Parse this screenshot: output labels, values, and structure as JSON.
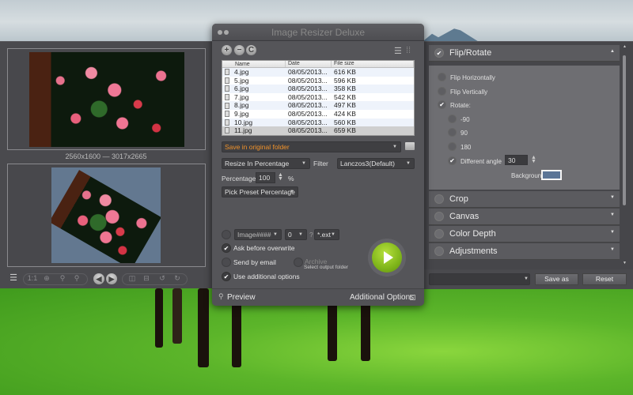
{
  "window": {
    "title": "Image Resizer Deluxe"
  },
  "preview": {
    "dimensions": "2560x1600 — 3017x2665",
    "toolbar": {
      "list_icon": "list-icon",
      "actual_size": "1:1",
      "fit_icon": "fit-icon",
      "zoom_out_icon": "zoom-out-icon",
      "zoom_in_icon": "zoom-in-icon",
      "prev_icon": "arrow-left-icon",
      "next_icon": "arrow-right-icon",
      "split_vertical_icon": "split-vertical-icon",
      "split_horizontal_icon": "split-horizontal-icon",
      "rotate_left_icon": "rotate-left-icon",
      "rotate_right_icon": "rotate-right-icon"
    }
  },
  "toolbar": {
    "add_label": "+",
    "remove_label": "−",
    "clear_label": "C",
    "list_view_icon": "list-view-icon",
    "grid_view_icon": "grid-view-icon"
  },
  "file_list": {
    "columns": [
      "Name",
      "Date",
      "File size"
    ],
    "rows": [
      {
        "name": "4.jpg",
        "date": "08/05/2013...",
        "size": "616 KB"
      },
      {
        "name": "5.jpg",
        "date": "08/05/2013...",
        "size": "596 KB"
      },
      {
        "name": "6.jpg",
        "date": "08/05/2013...",
        "size": "358 KB"
      },
      {
        "name": "7.jpg",
        "date": "08/05/2013...",
        "size": "542 KB"
      },
      {
        "name": "8.jpg",
        "date": "08/05/2013...",
        "size": "497 KB"
      },
      {
        "name": "9.jpg",
        "date": "08/05/2013...",
        "size": "424 KB"
      },
      {
        "name": "10.jpg",
        "date": "08/05/2013...",
        "size": "560 KB"
      },
      {
        "name": "11.jpg",
        "date": "08/05/2013...",
        "size": "659 KB",
        "selected": true
      }
    ]
  },
  "settings": {
    "save_location": "Save in original folder",
    "resize_mode": "Resize In Percentage",
    "filter_label": "Filter",
    "filter_value": "Lanczos3(Default)",
    "percentage_label": "Percentage:",
    "percentage_value": "100",
    "percent_sign": "%",
    "preset": "Pick Preset Percentage",
    "rename_pattern": "Image####",
    "rename_start": "0",
    "rename_question": "?",
    "rename_ext": "*.ext",
    "ask_overwrite": {
      "label": "Ask before overwrite",
      "checked": true
    },
    "send_email": {
      "label": "Send by email",
      "checked": false
    },
    "archive": {
      "label": "Archive",
      "sublabel": "Select output folder",
      "checked": false
    },
    "additional": {
      "label": "Use additional options",
      "checked": true
    }
  },
  "footer": {
    "preview_label": "Preview",
    "additional_options_label": "Additional Options"
  },
  "right_panel": {
    "sections": [
      {
        "label": "Flip/Rotate",
        "expanded": true,
        "enabled": true
      },
      {
        "label": "Crop",
        "expanded": false,
        "enabled": false
      },
      {
        "label": "Canvas",
        "expanded": false,
        "enabled": false
      },
      {
        "label": "Color Depth",
        "expanded": false,
        "enabled": false
      },
      {
        "label": "Adjustments",
        "expanded": false,
        "enabled": false
      }
    ],
    "flip": {
      "flip_h": "Flip Horizontally",
      "flip_v": "Flip Vertically",
      "rotate": "Rotate:",
      "neg90": "-90",
      "pos90": "90",
      "r180": "180",
      "different_angle": "Different angle",
      "angle_value": "30",
      "background_label": "Background:",
      "background_color": "#5b7596"
    },
    "preset_select": "",
    "save_as_label": "Save as",
    "reset_label": "Reset"
  }
}
